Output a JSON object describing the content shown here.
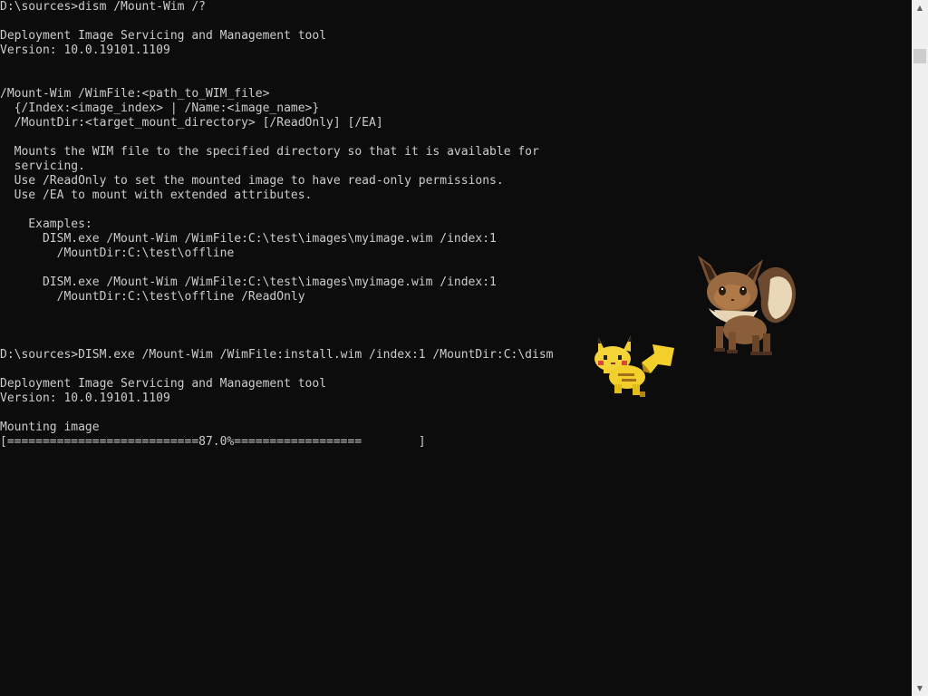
{
  "window": {
    "title": "",
    "foreground": "#cccccc",
    "background": "#0c0c0c"
  },
  "console": {
    "lines": [
      "D:\\sources>dism /Mount-Wim /?",
      "",
      "Deployment Image Servicing and Management tool",
      "Version: 10.0.19101.1109",
      "",
      "",
      "/Mount-Wim /WimFile:<path_to_WIM_file>",
      "  {/Index:<image_index> | /Name:<image_name>}",
      "  /MountDir:<target_mount_directory> [/ReadOnly] [/EA]",
      "",
      "  Mounts the WIM file to the specified directory so that it is available for",
      "  servicing.",
      "  Use /ReadOnly to set the mounted image to have read-only permissions.",
      "  Use /EA to mount with extended attributes.",
      "",
      "    Examples:",
      "      DISM.exe /Mount-Wim /WimFile:C:\\test\\images\\myimage.wim /index:1",
      "        /MountDir:C:\\test\\offline",
      "",
      "      DISM.exe /Mount-Wim /WimFile:C:\\test\\images\\myimage.wim /index:1",
      "        /MountDir:C:\\test\\offline /ReadOnly",
      "",
      "",
      "",
      "D:\\sources>DISM.exe /Mount-Wim /WimFile:install.wim /index:1 /MountDir:C:\\dism",
      "",
      "Deployment Image Servicing and Management tool",
      "Version: 10.0.19101.1109",
      "",
      "Mounting image",
      "[===========================87.0%==================        ]"
    ]
  },
  "progress": {
    "percent": 87.0
  },
  "scrollbar": {
    "up_icon": "scroll-up-arrow-icon",
    "down_icon": "scroll-down-arrow-icon",
    "position_fraction": 0.0
  },
  "sprites": [
    {
      "name": "eevee-sprite",
      "depicts": "eevee-icon"
    },
    {
      "name": "pikachu-sprite",
      "depicts": "pikachu-icon"
    }
  ]
}
